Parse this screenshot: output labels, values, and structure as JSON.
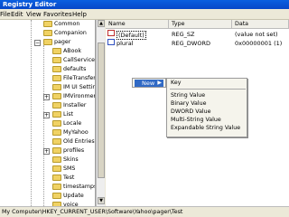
{
  "window": {
    "title": "Registry Editor"
  },
  "menu": {
    "file": "File",
    "edit": "Edit",
    "view": "View",
    "favorites": "Favorites",
    "help": "Help"
  },
  "tree": {
    "items": [
      {
        "label": "Common"
      },
      {
        "label": "Companion"
      },
      {
        "label": "pager"
      },
      {
        "label": "ABook"
      },
      {
        "label": "CallService"
      },
      {
        "label": "defaults"
      },
      {
        "label": "FileTransfer"
      },
      {
        "label": "IM UI Settin"
      },
      {
        "label": "IMVironment"
      },
      {
        "label": "Installer"
      },
      {
        "label": "List"
      },
      {
        "label": "Locale"
      },
      {
        "label": "MyYahoo"
      },
      {
        "label": "Old Entries"
      },
      {
        "label": "profiles"
      },
      {
        "label": "Skins"
      },
      {
        "label": "SMS"
      },
      {
        "label": "Test"
      },
      {
        "label": "timestamps"
      },
      {
        "label": "Update"
      },
      {
        "label": "voice"
      }
    ]
  },
  "columns": {
    "name": "Name",
    "type": "Type",
    "data": "Data"
  },
  "values": [
    {
      "name": "(Default)",
      "type": "REG_SZ",
      "data": "(value not set)"
    },
    {
      "name": "plural",
      "type": "REG_DWORD",
      "data": "0x00000001 (1)"
    }
  ],
  "context_menu": {
    "new_label": "New"
  },
  "submenu": {
    "key": "Key",
    "string": "String Value",
    "binary": "Binary Value",
    "dword": "DWORD Value",
    "multi": "Multi-String Value",
    "expand": "Expandable String Value"
  },
  "status": {
    "path": "My Computer\\HKEY_CURRENT_USER\\Software\\Yahoo\\pager\\Test"
  }
}
